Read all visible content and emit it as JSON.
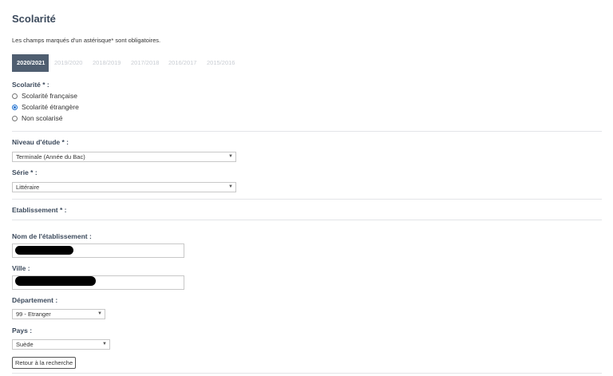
{
  "page": {
    "title": "Scolarité",
    "required_note": "Les champs marqués d'un astérisque* sont obligatoires."
  },
  "tabs": [
    {
      "label": "2020/2021",
      "active": true
    },
    {
      "label": "2019/2020",
      "active": false
    },
    {
      "label": "2018/2019",
      "active": false
    },
    {
      "label": "2017/2018",
      "active": false
    },
    {
      "label": "2016/2017",
      "active": false
    },
    {
      "label": "2015/2016",
      "active": false
    }
  ],
  "scolarite": {
    "label": "Scolarité * :",
    "options": [
      {
        "label": "Scolarité française",
        "checked": false
      },
      {
        "label": "Scolarité étrangère",
        "checked": true
      },
      {
        "label": "Non scolarisé",
        "checked": false
      }
    ]
  },
  "niveau": {
    "label": "Niveau d'étude * :",
    "value": "Terminale (Année du Bac)"
  },
  "serie": {
    "label": "Série * :",
    "value": "Littéraire"
  },
  "etablissement": {
    "label": "Etablissement * :"
  },
  "nom_etablissement": {
    "label": "Nom de l'établissement :"
  },
  "ville": {
    "label": "Ville :"
  },
  "departement": {
    "label": "Département :",
    "value": "99 - Etranger"
  },
  "pays": {
    "label": "Pays :",
    "value": "Suède"
  },
  "buttons": {
    "back": "Retour à la recherche"
  },
  "colors": {
    "tab_active": "#4f5e70",
    "heading": "#3c4a5c",
    "radio_accent": "#1a6fd0"
  }
}
